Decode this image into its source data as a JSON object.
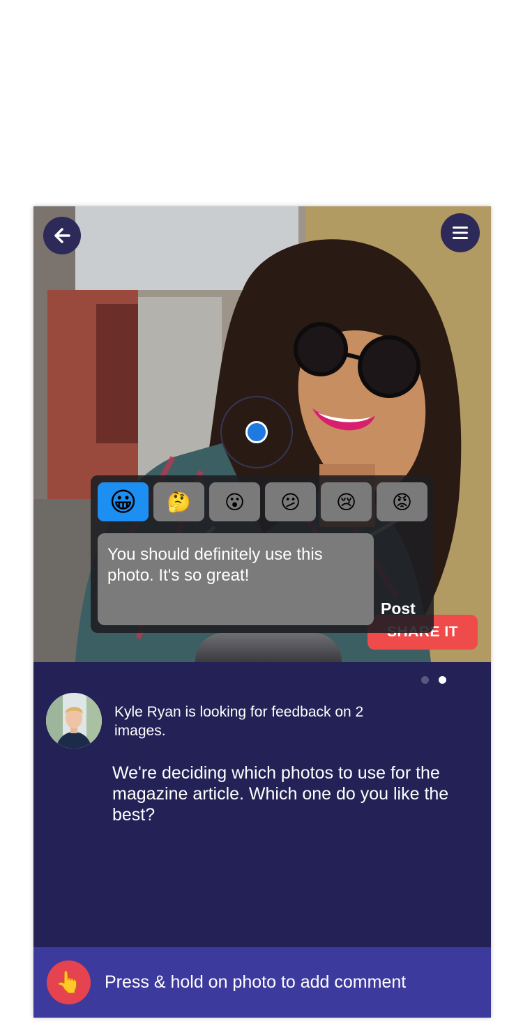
{
  "header": {
    "back_icon": "arrow-left-icon",
    "menu_icon": "hamburger-menu-icon"
  },
  "photo": {
    "share_label": "SHARE IT"
  },
  "reaction_popup": {
    "emojis": [
      {
        "name": "grinning",
        "glyph": "😀",
        "selected": true
      },
      {
        "name": "thinking",
        "glyph": "🤔",
        "selected": false
      },
      {
        "name": "surprised",
        "glyph": "😮",
        "selected": false
      },
      {
        "name": "confused",
        "glyph": "😕",
        "selected": false
      },
      {
        "name": "crying",
        "glyph": "😢",
        "selected": false
      },
      {
        "name": "angry",
        "glyph": "😡",
        "selected": false
      }
    ],
    "comment_text": "You should definitely use this photo. It's so great!",
    "post_label": "Post"
  },
  "pager": {
    "total": 2,
    "active_index": 1
  },
  "request": {
    "requester_text": "Kyle Ryan is looking for feedback on 2 images.",
    "description": "We're deciding which photos to use for the magazine article. Which one do you like the best?"
  },
  "hint": {
    "icon": "pointing-hand-icon",
    "glyph": "👆",
    "text": "Press & hold on photo to add comment"
  },
  "colors": {
    "card_bg": "#232155",
    "hint_bar_bg": "#3d3a9e",
    "accent_red": "#ef4b4b",
    "selected_emoji_bg": "#1e8ff2",
    "round_button_bg": "#2d2958"
  }
}
